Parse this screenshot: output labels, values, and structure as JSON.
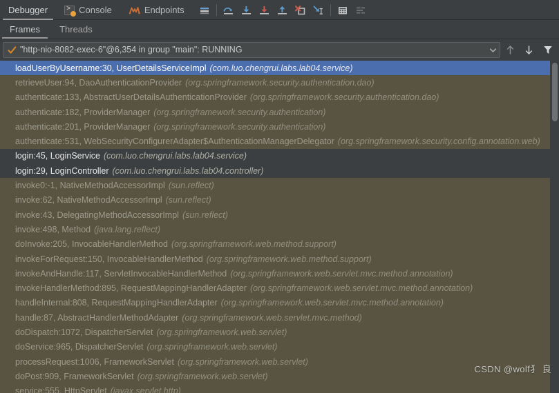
{
  "colors": {
    "background": "#3c3f41",
    "selected_row": "#4b6eaf",
    "library_row": "#595442",
    "project_row": "#3c3f41",
    "accent_orange": "#e8a33d",
    "accent_blue": "#4a90c4",
    "accent_red": "#d0564a"
  },
  "top_tabs": [
    {
      "label": "Debugger",
      "icon": "bug-icon",
      "active": true
    },
    {
      "label": "Console",
      "icon": "console-icon",
      "active": false
    },
    {
      "label": "Endpoints",
      "icon": "endpoints-icon",
      "active": false
    }
  ],
  "toolbar": [
    {
      "name": "mute-breakpoints-icon",
      "title": "Mute Breakpoints"
    },
    {
      "name": "step-over-icon",
      "title": "Step Over"
    },
    {
      "name": "step-into-icon",
      "title": "Step Into"
    },
    {
      "name": "force-step-into-icon",
      "title": "Force Step Into"
    },
    {
      "name": "step-out-icon",
      "title": "Step Out"
    },
    {
      "name": "drop-frame-icon",
      "title": "Drop Frame"
    },
    {
      "name": "run-to-cursor-icon",
      "title": "Run to Cursor"
    },
    {
      "name": "evaluate-expression-icon",
      "title": "Evaluate Expression"
    },
    {
      "name": "settings-icon",
      "title": "Layout Settings"
    }
  ],
  "sub_tabs": [
    {
      "label": "Frames",
      "active": true
    },
    {
      "label": "Threads",
      "active": false
    }
  ],
  "thread_selector": {
    "value": "\"http-nio-8082-exec-6\"@6,354 in group \"main\": RUNNING",
    "status_icon": "running-check-icon",
    "dropdown_icon": "chevron-down-icon",
    "nav_up_icon": "arrow-up-icon",
    "nav_down_icon": "arrow-down-icon",
    "filter_icon": "filter-funnel-icon"
  },
  "frames": [
    {
      "method": "loadUserByUsername:30, UserDetailsServiceImpl",
      "package": "(com.luo.chengrui.labs.lab04.service)",
      "kind": "selected"
    },
    {
      "method": "retrieveUser:94, DaoAuthenticationProvider",
      "package": "(org.springframework.security.authentication.dao)",
      "kind": "lib"
    },
    {
      "method": "authenticate:133, AbstractUserDetailsAuthenticationProvider",
      "package": "(org.springframework.security.authentication.dao)",
      "kind": "lib"
    },
    {
      "method": "authenticate:182, ProviderManager",
      "package": "(org.springframework.security.authentication)",
      "kind": "lib"
    },
    {
      "method": "authenticate:201, ProviderManager",
      "package": "(org.springframework.security.authentication)",
      "kind": "lib"
    },
    {
      "method": "authenticate:531, WebSecurityConfigurerAdapter$AuthenticationManagerDelegator",
      "package": "(org.springframework.security.config.annotation.web)",
      "kind": "lib"
    },
    {
      "method": "login:45, LoginService",
      "package": "(com.luo.chengrui.labs.lab04.service)",
      "kind": "proj"
    },
    {
      "method": "login:29, LoginController",
      "package": "(com.luo.chengrui.labs.lab04.controller)",
      "kind": "proj"
    },
    {
      "method": "invoke0:-1, NativeMethodAccessorImpl",
      "package": "(sun.reflect)",
      "kind": "lib"
    },
    {
      "method": "invoke:62, NativeMethodAccessorImpl",
      "package": "(sun.reflect)",
      "kind": "lib"
    },
    {
      "method": "invoke:43, DelegatingMethodAccessorImpl",
      "package": "(sun.reflect)",
      "kind": "lib"
    },
    {
      "method": "invoke:498, Method",
      "package": "(java.lang.reflect)",
      "kind": "lib"
    },
    {
      "method": "doInvoke:205, InvocableHandlerMethod",
      "package": "(org.springframework.web.method.support)",
      "kind": "lib"
    },
    {
      "method": "invokeForRequest:150, InvocableHandlerMethod",
      "package": "(org.springframework.web.method.support)",
      "kind": "lib"
    },
    {
      "method": "invokeAndHandle:117, ServletInvocableHandlerMethod",
      "package": "(org.springframework.web.servlet.mvc.method.annotation)",
      "kind": "lib"
    },
    {
      "method": "invokeHandlerMethod:895, RequestMappingHandlerAdapter",
      "package": "(org.springframework.web.servlet.mvc.method.annotation)",
      "kind": "lib"
    },
    {
      "method": "handleInternal:808, RequestMappingHandlerAdapter",
      "package": "(org.springframework.web.servlet.mvc.method.annotation)",
      "kind": "lib"
    },
    {
      "method": "handle:87, AbstractHandlerMethodAdapter",
      "package": "(org.springframework.web.servlet.mvc.method)",
      "kind": "lib"
    },
    {
      "method": "doDispatch:1072, DispatcherServlet",
      "package": "(org.springframework.web.servlet)",
      "kind": "lib"
    },
    {
      "method": "doService:965, DispatcherServlet",
      "package": "(org.springframework.web.servlet)",
      "kind": "lib"
    },
    {
      "method": "processRequest:1006, FrameworkServlet",
      "package": "(org.springframework.web.servlet)",
      "kind": "lib"
    },
    {
      "method": "doPost:909, FrameworkServlet",
      "package": "(org.springframework.web.servlet)",
      "kind": "lib"
    },
    {
      "method": "service:555, HttpServlet",
      "package": "(javax.servlet.http)",
      "kind": "lib"
    }
  ],
  "watermark": {
    "text": "CSDN @wolf犭 良"
  }
}
